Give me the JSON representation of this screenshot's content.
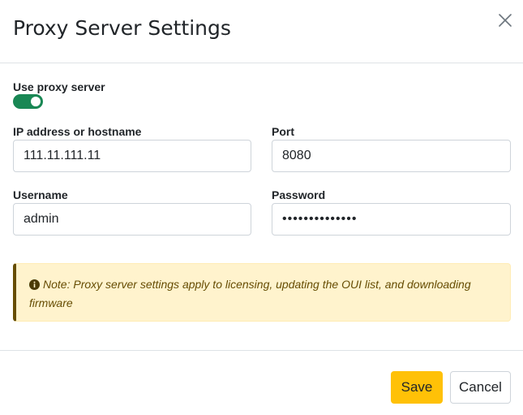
{
  "dialog": {
    "title": "Proxy Server Settings",
    "close_icon": "close-icon"
  },
  "form": {
    "use_proxy": {
      "label": "Use proxy server",
      "enabled": true
    },
    "ip_address": {
      "label": "IP address or hostname",
      "value": "111.11.111.11"
    },
    "port": {
      "label": "Port",
      "value": "8080"
    },
    "username": {
      "label": "Username",
      "value": "admin"
    },
    "password": {
      "label": "Password",
      "value": "••••••••••••••"
    }
  },
  "note": {
    "icon": "info-circle-icon",
    "text": "Note: Proxy server settings apply to licensing, updating the OUI list, and downloading firmware"
  },
  "footer": {
    "save_label": "Save",
    "cancel_label": "Cancel"
  },
  "colors": {
    "toggle_on": "#198754",
    "save_button": "#ffc107",
    "alert_background": "#fff3cd",
    "alert_text": "#664d03"
  }
}
